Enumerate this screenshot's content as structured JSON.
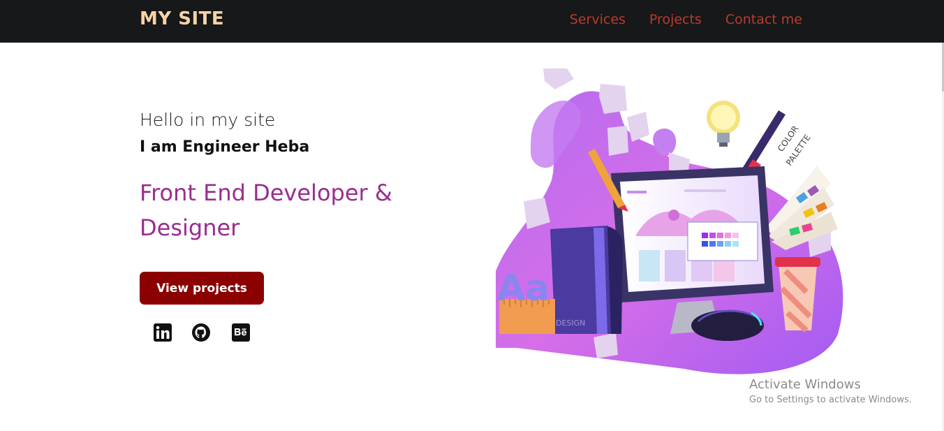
{
  "nav": {
    "brand": "MY SITE",
    "links": [
      {
        "label": "Services"
      },
      {
        "label": "Projects"
      },
      {
        "label": "Contact me"
      }
    ]
  },
  "hero": {
    "greeting": "Hello in my site",
    "name_line": "I am Engineer Heba",
    "role": "Front End Developer & Designer",
    "cta_label": "View projects",
    "social_icons": [
      "linkedin-icon",
      "github-icon",
      "behance-icon"
    ]
  },
  "illustration": {
    "palette_label_1": "COLOR",
    "palette_label_2": "PALETTE",
    "book_label": "DESIGN",
    "letters": "Aa"
  },
  "watermark": {
    "title": "Activate Windows",
    "subtitle": "Go to Settings to activate Windows."
  },
  "colors": {
    "navbar_bg": "#161819",
    "brand": "#f7d2a7",
    "nav_link": "#c0392b",
    "role_text": "#9b2c8f",
    "cta_bg": "#8b0000"
  }
}
